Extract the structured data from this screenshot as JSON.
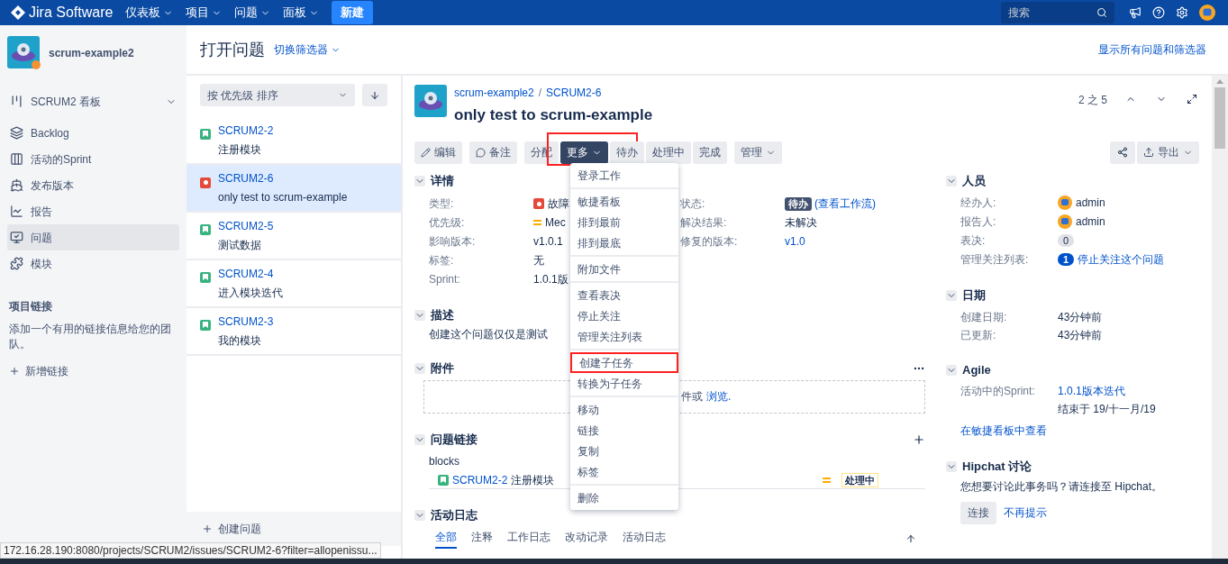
{
  "top_nav": {
    "logo": "Jira Software",
    "menus": [
      {
        "label": "仪表板"
      },
      {
        "label": "项目"
      },
      {
        "label": "问题"
      },
      {
        "label": "面板"
      }
    ],
    "create_button": "新建",
    "search": {
      "placeholder": "搜索"
    }
  },
  "sidebar": {
    "project_name": "scrum-example2",
    "items": [
      {
        "label": "SCRUM2 看板",
        "kind": "board",
        "selected": false
      },
      {
        "label": "Backlog",
        "kind": "backlog",
        "selected": false
      },
      {
        "label": "活动的Sprint",
        "kind": "sprint",
        "selected": false
      },
      {
        "label": "发布版本",
        "kind": "release",
        "selected": false
      },
      {
        "label": "报告",
        "kind": "report",
        "selected": false
      },
      {
        "label": "问题",
        "kind": "issues",
        "selected": true
      },
      {
        "label": "模块",
        "kind": "components",
        "selected": false
      }
    ],
    "project_links": {
      "title": "项目链接",
      "text": "添加一个有用的链接信息给您的团队。",
      "add_link": "新增链接"
    }
  },
  "page_header": {
    "title": "打开问题",
    "filter_switch": "切换筛选器",
    "show_all": "显示所有问题和筛选器"
  },
  "issue_list": {
    "sort": "按 优先级 排序",
    "issues": [
      {
        "key": "SCRUM2-2",
        "summary": "注册模块",
        "kind": "story",
        "selected": false
      },
      {
        "key": "SCRUM2-6",
        "summary": "only test to scrum-example",
        "kind": "bug",
        "selected": true
      },
      {
        "key": "SCRUM2-5",
        "summary": "测试数据",
        "kind": "story",
        "selected": false
      },
      {
        "key": "SCRUM2-4",
        "summary": "进入模块迭代",
        "kind": "story",
        "selected": false
      },
      {
        "key": "SCRUM2-3",
        "summary": "我的模块",
        "kind": "story",
        "selected": false
      }
    ],
    "create_issue": "创建问题"
  },
  "issue": {
    "breadcrumb": [
      "scrum-example2",
      "SCRUM2-6"
    ],
    "breadcrumb_separator": "/",
    "title": "only test to scrum-example",
    "pager": "2 之 5",
    "toolbar": [
      {
        "label": "编辑",
        "kind": "edit",
        "selected": false,
        "highlighted": false
      },
      {
        "label": "备注",
        "kind": "comment",
        "selected": false,
        "highlighted": false
      },
      {
        "label": "分配",
        "kind": "group",
        "selected": false,
        "highlighted": false
      },
      {
        "label": "更多",
        "kind": "group-dropdown",
        "selected": true,
        "highlighted": true
      },
      {
        "label": "待办",
        "kind": "group",
        "selected": false,
        "highlighted": false
      },
      {
        "label": "处理中",
        "kind": "group",
        "selected": false,
        "highlighted": false
      },
      {
        "label": "完成",
        "kind": "group",
        "selected": false,
        "highlighted": false
      },
      {
        "label": "管理",
        "kind": "dropdown",
        "selected": false,
        "highlighted": false
      }
    ],
    "export": "导出",
    "details": {
      "title": "详情",
      "left": [
        {
          "label": "类型:",
          "value": "故障",
          "kind": "bug"
        },
        {
          "label": "优先级:",
          "value": "Mec",
          "kind": "priority"
        },
        {
          "label": "影响版本:",
          "value": "v1.0.1",
          "kind": "text"
        },
        {
          "label": "标签:",
          "value": "无",
          "kind": "text"
        },
        {
          "label": "Sprint:",
          "value": "1.0.1版",
          "kind": "text"
        }
      ],
      "right": [
        {
          "label": "状态:",
          "value": "待办",
          "kind": "status",
          "link": "(查看工作流)"
        },
        {
          "label": "解决结果:",
          "value": "未解决",
          "kind": "text"
        },
        {
          "label": "修复的版本:",
          "value": "v1.0",
          "kind": "link"
        }
      ]
    },
    "description": {
      "title": "描述",
      "text": "创建这个问题仅仅是测试"
    },
    "attachments": {
      "title": "附件",
      "drop_text": "件或",
      "browse": "浏览."
    },
    "links": {
      "title": "问题链接",
      "type": "blocks",
      "items": [
        {
          "key": "SCRUM2-2",
          "summary": "注册模块",
          "status": "处理中"
        }
      ]
    },
    "activity": {
      "title": "活动日志",
      "tabs": [
        {
          "label": "全部",
          "selected": true
        },
        {
          "label": "注释",
          "selected": false
        },
        {
          "label": "工作日志",
          "selected": false
        },
        {
          "label": "改动记录",
          "selected": false
        },
        {
          "label": "活动日志",
          "selected": false
        }
      ]
    },
    "people": {
      "title": "人员",
      "rows": [
        {
          "label": "经办人:",
          "value": "admin",
          "kind": "user"
        },
        {
          "label": "报告人:",
          "value": "admin",
          "kind": "user"
        },
        {
          "label": "表决:",
          "value": "0",
          "kind": "count"
        },
        {
          "label": "管理关注列表:",
          "value": "1",
          "kind": "watch",
          "link": "停止关注这个问题"
        }
      ]
    },
    "dates": {
      "title": "日期",
      "rows": [
        {
          "label": "创建日期:",
          "value": "43分钟前"
        },
        {
          "label": "已更新:",
          "value": "43分钟前"
        }
      ]
    },
    "agile": {
      "title": "Agile",
      "label": "活动中的Sprint:",
      "sprint": "1.0.1版本迭代",
      "ends": "结束于 19/十一月/19",
      "board_link": "在敏捷看板中查看"
    },
    "hipchat": {
      "title": "Hipchat 讨论",
      "text": "您想要讨论此事务吗？请连接至 Hipchat。",
      "connect": "连接",
      "dismiss": "不再提示"
    }
  },
  "more_menu": {
    "groups": [
      [
        {
          "label": "登录工作",
          "highlighted": false
        }
      ],
      [
        {
          "label": "敏捷看板",
          "highlighted": false
        },
        {
          "label": "排到最前",
          "highlighted": false
        },
        {
          "label": "排到最底",
          "highlighted": false
        }
      ],
      [
        {
          "label": "附加文件",
          "highlighted": false
        }
      ],
      [
        {
          "label": "查看表决",
          "highlighted": false
        },
        {
          "label": "停止关注",
          "highlighted": false
        },
        {
          "label": "管理关注列表",
          "highlighted": false
        }
      ],
      [
        {
          "label": "创建子任务",
          "highlighted": true
        },
        {
          "label": "转换为子任务",
          "highlighted": false
        }
      ],
      [
        {
          "label": "移动",
          "highlighted": false
        },
        {
          "label": "链接",
          "highlighted": false
        },
        {
          "label": "复制",
          "highlighted": false
        },
        {
          "label": "标签",
          "highlighted": false
        }
      ],
      [
        {
          "label": "删除",
          "highlighted": false
        }
      ]
    ]
  },
  "status_bar_url": "172.16.28.190:8080/projects/SCRUM2/issues/SCRUM2-6?filter=allopenissu..."
}
